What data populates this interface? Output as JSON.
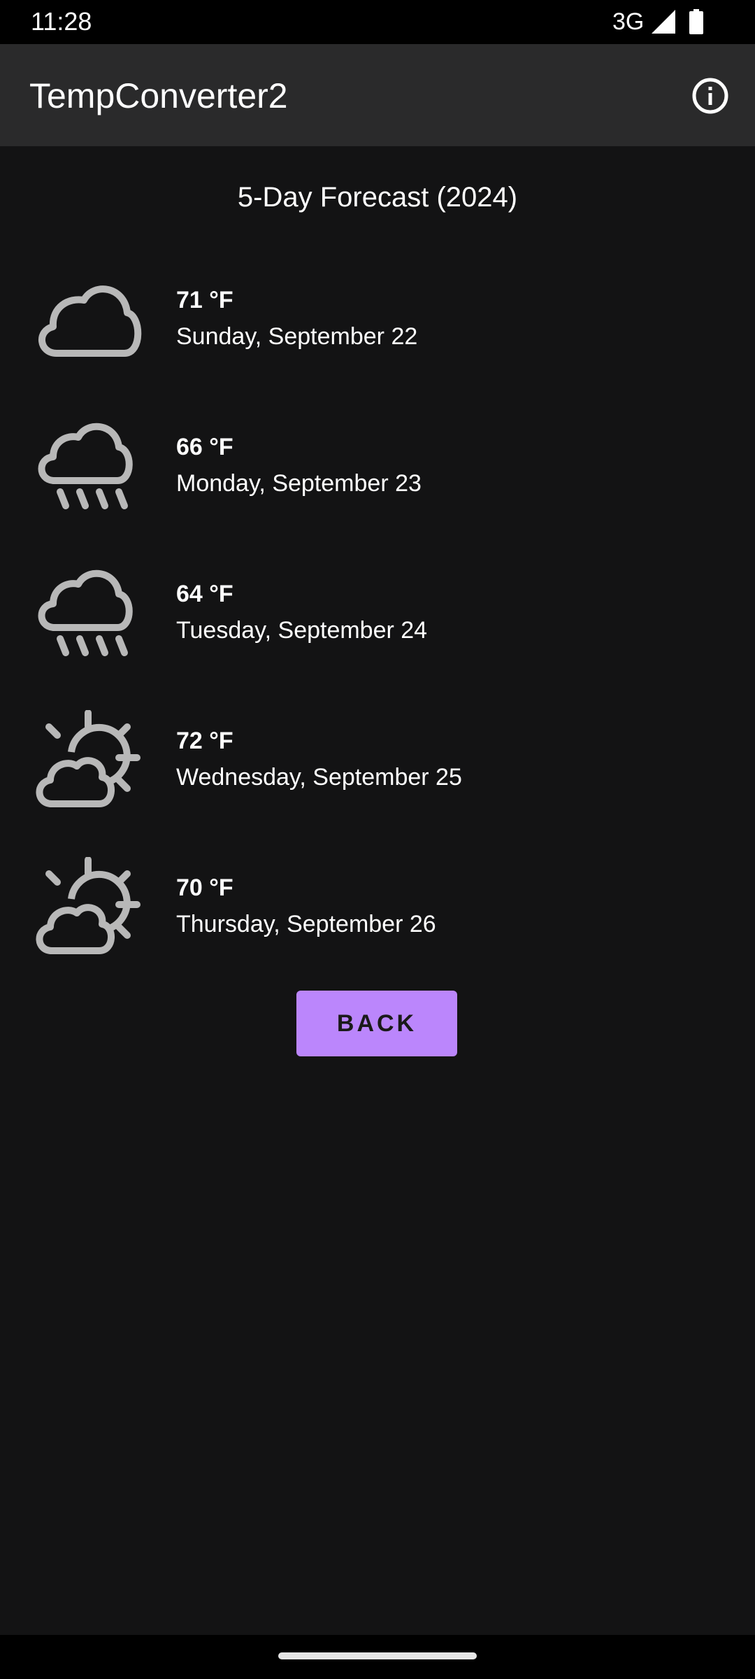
{
  "status_bar": {
    "time": "11:28",
    "network": "3G",
    "icons": [
      "signal-icon",
      "battery-icon"
    ]
  },
  "app_bar": {
    "title": "TempConverter2",
    "info_icon": "info-icon"
  },
  "forecast": {
    "title": "5-Day Forecast (2024)",
    "days": [
      {
        "icon": "cloud-icon",
        "temperature": "71 °F",
        "date": "Sunday, September 22"
      },
      {
        "icon": "rain-icon",
        "temperature": "66 °F",
        "date": "Monday, September 23"
      },
      {
        "icon": "rain-icon",
        "temperature": "64 °F",
        "date": "Tuesday, September 24"
      },
      {
        "icon": "partly-sunny-icon",
        "temperature": "72 °F",
        "date": "Wednesday, September 25"
      },
      {
        "icon": "partly-sunny-icon",
        "temperature": "70 °F",
        "date": "Thursday, September 26"
      }
    ]
  },
  "actions": {
    "back_label": "BACK"
  },
  "colors": {
    "background": "#131314",
    "app_bar": "#2a2a2b",
    "accent": "#bb86fc",
    "icon": "#b8b8b8"
  }
}
